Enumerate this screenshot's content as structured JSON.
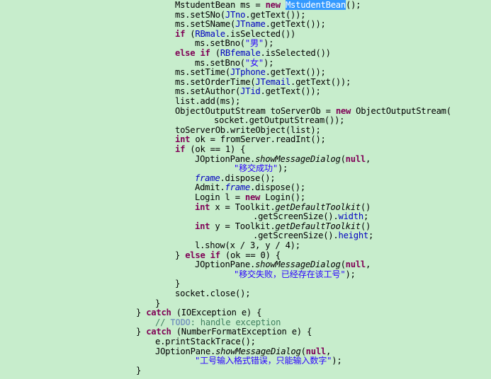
{
  "editor": {
    "lines": [
      {
        "indent": 247,
        "tokens": [
          {
            "t": "MstudentBean ms = ",
            "c": "plain"
          },
          {
            "t": "new",
            "c": "kw"
          },
          {
            "t": " ",
            "c": "plain"
          },
          {
            "t": "MstudentBean",
            "c": "sel"
          },
          {
            "t": "();",
            "c": "plain"
          }
        ]
      },
      {
        "indent": 247,
        "tokens": [
          {
            "t": "ms.setSNo(",
            "c": "plain"
          },
          {
            "t": "JTno",
            "c": "field"
          },
          {
            "t": ".getText());",
            "c": "plain"
          }
        ]
      },
      {
        "indent": 247,
        "tokens": [
          {
            "t": "ms.setSName(",
            "c": "plain"
          },
          {
            "t": "JTname",
            "c": "field"
          },
          {
            "t": ".getText());",
            "c": "plain"
          }
        ]
      },
      {
        "indent": 247,
        "tokens": [
          {
            "t": "if",
            "c": "kw"
          },
          {
            "t": " (",
            "c": "plain"
          },
          {
            "t": "RBmale",
            "c": "field"
          },
          {
            "t": ".isSelected())",
            "c": "plain"
          }
        ]
      },
      {
        "indent": 275,
        "tokens": [
          {
            "t": "ms.setBno(",
            "c": "plain"
          },
          {
            "t": "\"男\"",
            "c": "str"
          },
          {
            "t": ");",
            "c": "plain"
          }
        ]
      },
      {
        "indent": 247,
        "tokens": [
          {
            "t": "else",
            "c": "kw"
          },
          {
            "t": " ",
            "c": "plain"
          },
          {
            "t": "if",
            "c": "kw"
          },
          {
            "t": " (",
            "c": "plain"
          },
          {
            "t": "RBfemale",
            "c": "field"
          },
          {
            "t": ".isSelected())",
            "c": "plain"
          }
        ]
      },
      {
        "indent": 275,
        "tokens": [
          {
            "t": "ms.setBno(",
            "c": "plain"
          },
          {
            "t": "\"女\"",
            "c": "str"
          },
          {
            "t": ");",
            "c": "plain"
          }
        ]
      },
      {
        "indent": 247,
        "tokens": [
          {
            "t": "ms.setTime(",
            "c": "plain"
          },
          {
            "t": "JTphone",
            "c": "field"
          },
          {
            "t": ".getText());",
            "c": "plain"
          }
        ]
      },
      {
        "indent": 247,
        "tokens": [
          {
            "t": "ms.setOrderTime(",
            "c": "plain"
          },
          {
            "t": "JTemail",
            "c": "field"
          },
          {
            "t": ".getText());",
            "c": "plain"
          }
        ]
      },
      {
        "indent": 247,
        "tokens": [
          {
            "t": "ms.setAuthor(",
            "c": "plain"
          },
          {
            "t": "JTid",
            "c": "field"
          },
          {
            "t": ".getText());",
            "c": "plain"
          }
        ]
      },
      {
        "indent": 247,
        "tokens": [
          {
            "t": "list.add(ms);",
            "c": "plain"
          }
        ]
      },
      {
        "indent": 247,
        "tokens": [
          {
            "t": "ObjectOutputStream toServerOb = ",
            "c": "plain"
          },
          {
            "t": "new",
            "c": "kw"
          },
          {
            "t": " ObjectOutputStream(",
            "c": "plain"
          }
        ]
      },
      {
        "indent": 302,
        "tokens": [
          {
            "t": "socket.getOutputStream());",
            "c": "plain"
          }
        ]
      },
      {
        "indent": 247,
        "tokens": [
          {
            "t": "toServerOb.writeObject(list);",
            "c": "plain"
          }
        ]
      },
      {
        "indent": 247,
        "tokens": [
          {
            "t": "int",
            "c": "kw"
          },
          {
            "t": " ok = fromServer.readInt();",
            "c": "plain"
          }
        ]
      },
      {
        "indent": 247,
        "tokens": [
          {
            "t": "if",
            "c": "kw"
          },
          {
            "t": " (ok == 1) {",
            "c": "plain"
          }
        ]
      },
      {
        "indent": 275,
        "tokens": [
          {
            "t": "JOptionPane.",
            "c": "plain"
          },
          {
            "t": "showMessageDialog",
            "c": "static"
          },
          {
            "t": "(",
            "c": "plain"
          },
          {
            "t": "null",
            "c": "kw"
          },
          {
            "t": ",",
            "c": "plain"
          }
        ]
      },
      {
        "indent": 330,
        "tokens": [
          {
            "t": "\"移交成功\"",
            "c": "str"
          },
          {
            "t": ");",
            "c": "plain"
          }
        ]
      },
      {
        "indent": 275,
        "tokens": [
          {
            "t": "frame",
            "c": "sfield"
          },
          {
            "t": ".dispose();",
            "c": "plain"
          }
        ]
      },
      {
        "indent": 275,
        "tokens": [
          {
            "t": "Admit.",
            "c": "plain"
          },
          {
            "t": "frame",
            "c": "sfield"
          },
          {
            "t": ".dispose();",
            "c": "plain"
          }
        ]
      },
      {
        "indent": 275,
        "tokens": [
          {
            "t": "Login l = ",
            "c": "plain"
          },
          {
            "t": "new",
            "c": "kw"
          },
          {
            "t": " Login();",
            "c": "plain"
          }
        ]
      },
      {
        "indent": 275,
        "tokens": [
          {
            "t": "int",
            "c": "kw"
          },
          {
            "t": " x = Toolkit.",
            "c": "plain"
          },
          {
            "t": "getDefaultToolkit",
            "c": "static"
          },
          {
            "t": "()",
            "c": "plain"
          }
        ]
      },
      {
        "indent": 357,
        "tokens": [
          {
            "t": ".getScreenSize().",
            "c": "plain"
          },
          {
            "t": "width",
            "c": "field"
          },
          {
            "t": ";",
            "c": "plain"
          }
        ]
      },
      {
        "indent": 275,
        "tokens": [
          {
            "t": "int",
            "c": "kw"
          },
          {
            "t": " y = Toolkit.",
            "c": "plain"
          },
          {
            "t": "getDefaultToolkit",
            "c": "static"
          },
          {
            "t": "()",
            "c": "plain"
          }
        ]
      },
      {
        "indent": 357,
        "tokens": [
          {
            "t": ".getScreenSize().",
            "c": "plain"
          },
          {
            "t": "height",
            "c": "field"
          },
          {
            "t": ";",
            "c": "plain"
          }
        ]
      },
      {
        "indent": 275,
        "tokens": [
          {
            "t": "l.show(x / 3, y / 4);",
            "c": "plain"
          }
        ]
      },
      {
        "indent": 247,
        "tokens": [
          {
            "t": "} ",
            "c": "plain"
          },
          {
            "t": "else",
            "c": "kw"
          },
          {
            "t": " ",
            "c": "plain"
          },
          {
            "t": "if",
            "c": "kw"
          },
          {
            "t": " (ok == 0) {",
            "c": "plain"
          }
        ]
      },
      {
        "indent": 275,
        "tokens": [
          {
            "t": "JOptionPane.",
            "c": "plain"
          },
          {
            "t": "showMessageDialog",
            "c": "static"
          },
          {
            "t": "(",
            "c": "plain"
          },
          {
            "t": "null",
            "c": "kw"
          },
          {
            "t": ",",
            "c": "plain"
          }
        ]
      },
      {
        "indent": 330,
        "tokens": [
          {
            "t": "\"移交失败，已经存在该工号\"",
            "c": "str"
          },
          {
            "t": ");",
            "c": "plain"
          }
        ]
      },
      {
        "indent": 247,
        "tokens": [
          {
            "t": "}",
            "c": "plain"
          }
        ]
      },
      {
        "indent": 247,
        "tokens": [
          {
            "t": "socket.close();",
            "c": "plain"
          }
        ]
      },
      {
        "indent": 219,
        "tokens": [
          {
            "t": "}",
            "c": "plain"
          }
        ]
      },
      {
        "indent": 192,
        "tokens": [
          {
            "t": "} ",
            "c": "plain"
          },
          {
            "t": "catch",
            "c": "kw"
          },
          {
            "t": " (IOException e) {",
            "c": "plain"
          }
        ]
      },
      {
        "indent": 219,
        "tokens": [
          {
            "t": "// ",
            "c": "comment"
          },
          {
            "t": "TODO",
            "c": "todo"
          },
          {
            "t": ": handle exception",
            "c": "comment"
          }
        ]
      },
      {
        "indent": 192,
        "tokens": [
          {
            "t": "} ",
            "c": "plain"
          },
          {
            "t": "catch",
            "c": "kw"
          },
          {
            "t": " (NumberFormatException e) {",
            "c": "plain"
          }
        ]
      },
      {
        "indent": 219,
        "tokens": [
          {
            "t": "e.printStackTrace();",
            "c": "plain"
          }
        ]
      },
      {
        "indent": 219,
        "tokens": [
          {
            "t": "JOptionPane.",
            "c": "plain"
          },
          {
            "t": "showMessageDialog",
            "c": "static"
          },
          {
            "t": "(",
            "c": "plain"
          },
          {
            "t": "null",
            "c": "kw"
          },
          {
            "t": ",",
            "c": "plain"
          }
        ]
      },
      {
        "indent": 275,
        "tokens": [
          {
            "t": "\"工号输入格式错误，只能输入数字\"",
            "c": "str"
          },
          {
            "t": ");",
            "c": "plain"
          }
        ]
      },
      {
        "indent": 192,
        "tokens": [
          {
            "t": "}",
            "c": "plain"
          }
        ]
      }
    ]
  },
  "colors": {
    "background": "#c7edcc",
    "keyword": "#7f0055",
    "field": "#0000c0",
    "string": "#2a00ff",
    "comment": "#3f7f5f",
    "selection": "#3399ff"
  }
}
